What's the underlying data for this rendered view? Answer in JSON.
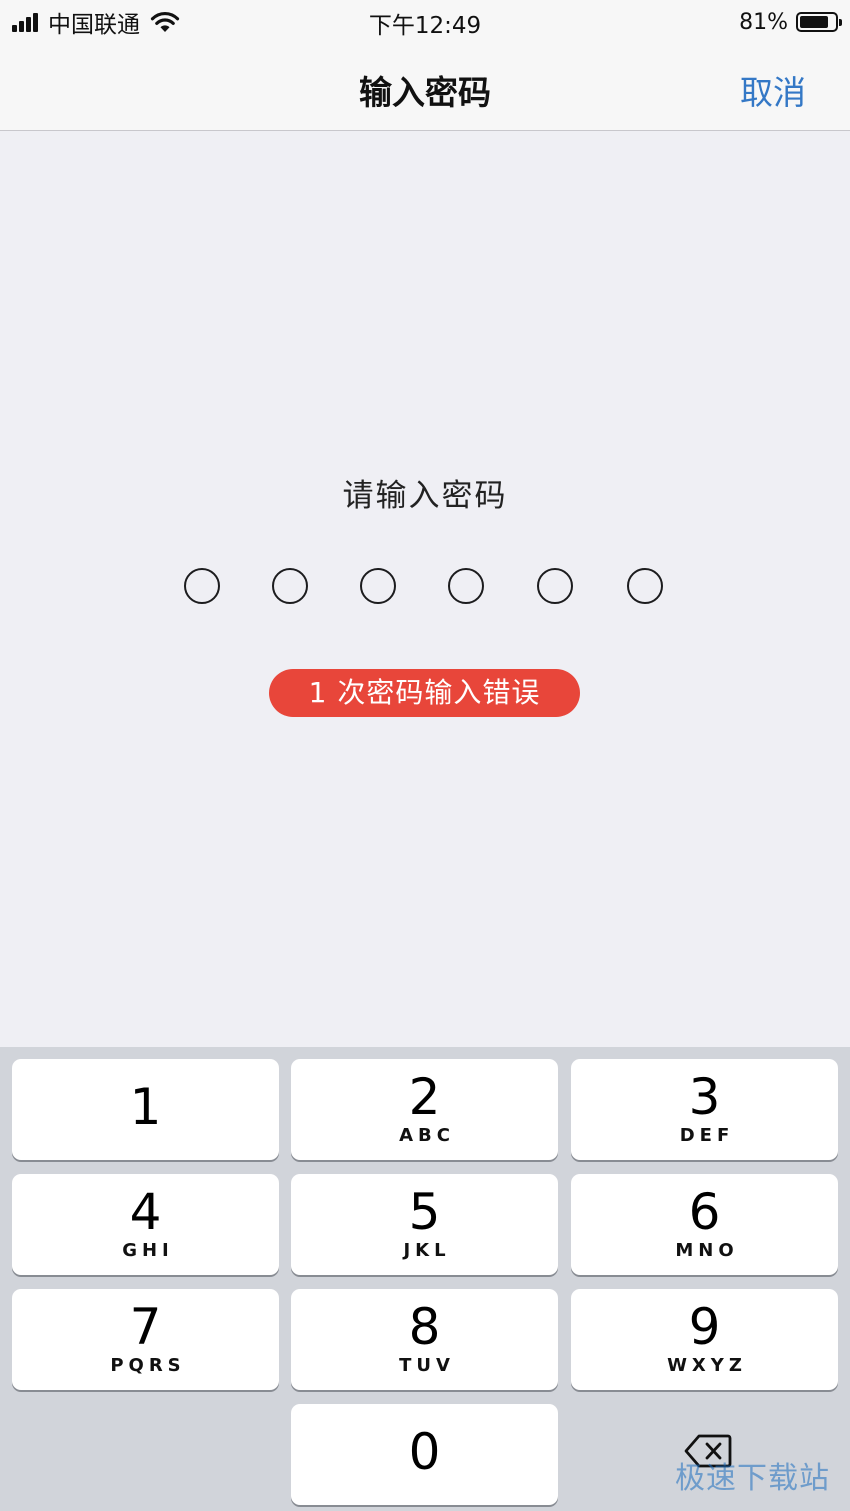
{
  "status_bar": {
    "carrier": "中国联通",
    "time": "下午12:49",
    "battery_percent_text": "81%",
    "battery_level": 0.81,
    "signal_icon": "signal-bars-icon",
    "wifi_icon": "wifi-icon",
    "battery_icon": "battery-icon"
  },
  "nav": {
    "title": "输入密码",
    "cancel": "取消",
    "accent_color": "#3478c6"
  },
  "prompt": "请输入密码",
  "passcode": {
    "length": 6,
    "filled": 0
  },
  "error": {
    "text": "1 次密码输入错误",
    "color": "#e8463a"
  },
  "keypad": {
    "keys": [
      {
        "num": "1",
        "letters": ""
      },
      {
        "num": "2",
        "letters": "ABC"
      },
      {
        "num": "3",
        "letters": "DEF"
      },
      {
        "num": "4",
        "letters": "GHI"
      },
      {
        "num": "5",
        "letters": "JKL"
      },
      {
        "num": "6",
        "letters": "MNO"
      },
      {
        "num": "7",
        "letters": "PQRS"
      },
      {
        "num": "8",
        "letters": "TUV"
      },
      {
        "num": "9",
        "letters": "WXYZ"
      },
      {
        "num": "0",
        "letters": ""
      }
    ],
    "delete_icon": "backspace-icon"
  },
  "watermark": "极速下载站"
}
